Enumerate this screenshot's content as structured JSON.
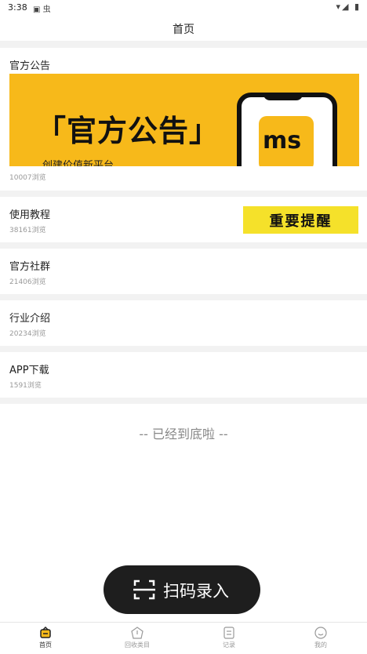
{
  "status_bar": {
    "time": "3:38",
    "left_icons": "▣ 虫",
    "right_icons": "▾◢ ▮"
  },
  "header": {
    "title": "首页"
  },
  "articles": [
    {
      "title": "官方公告",
      "views": "10007浏览",
      "banner": {
        "headline": "「官方公告」",
        "subline": "创建价值新平台",
        "logo": "ms"
      }
    },
    {
      "title": "使用教程",
      "views": "38161浏览",
      "badge": "重要提醒"
    },
    {
      "title": "官方社群",
      "views": "21406浏览"
    },
    {
      "title": "行业介绍",
      "views": "20234浏览"
    },
    {
      "title": "APP下载",
      "views": "1591浏览"
    }
  ],
  "end_text": "-- 已经到底啦 --",
  "scan_button": {
    "label": "扫码录入"
  },
  "tabs": [
    {
      "label": "首页",
      "icon": "home-icon",
      "active": true
    },
    {
      "label": "回收类目",
      "icon": "recycle-category-icon",
      "active": false
    },
    {
      "label": "记录",
      "icon": "record-icon",
      "active": false
    },
    {
      "label": "我的",
      "icon": "profile-icon",
      "active": false
    }
  ],
  "colors": {
    "accent": "#f7b91a",
    "badge": "#f5e12a",
    "button": "#1e1e1e"
  }
}
